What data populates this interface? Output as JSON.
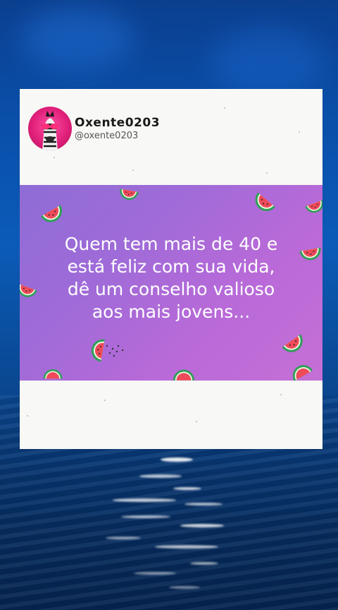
{
  "post": {
    "display_name": "Oxente0203",
    "handle": "@oxente0203",
    "message_lines": [
      "Quem tem mais de 40 e",
      "está feliz com sua vida,",
      "dê um conselho valioso",
      "aos mais jovens..."
    ]
  },
  "colors": {
    "banner_start": "#8f6cd6",
    "banner_end": "#c56fd6",
    "background_sea": "#0b5bb8",
    "avatar_bg": "#e0207a"
  },
  "icons": {
    "avatar": "zebra-with-sunglasses-avatar",
    "decoration": "watermelon-slice-icon"
  }
}
